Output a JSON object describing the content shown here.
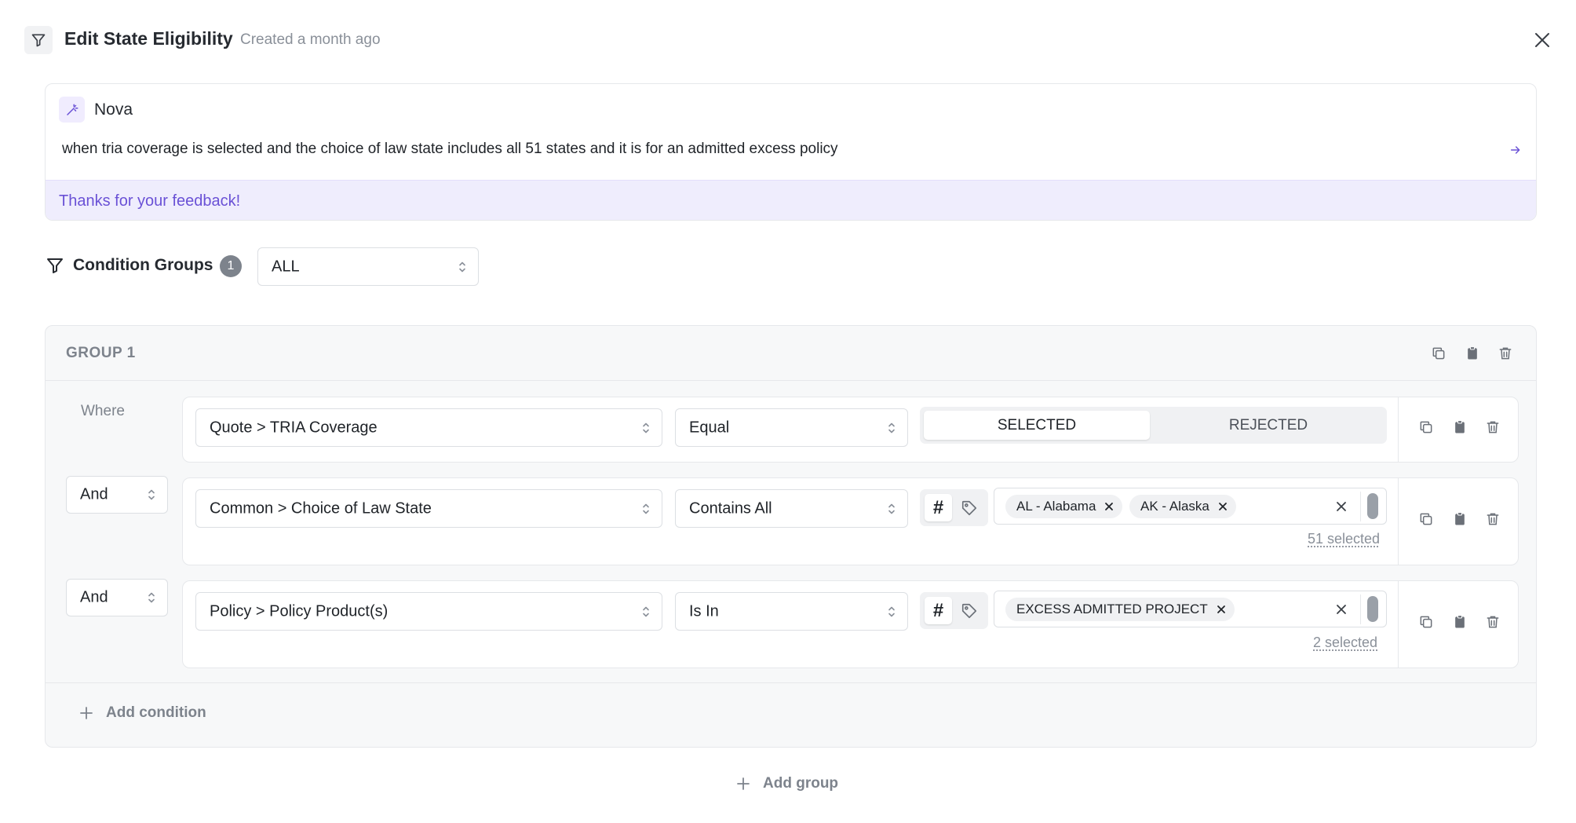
{
  "header": {
    "title": "Edit State Eligibility",
    "subtitle": "Created a month ago"
  },
  "nova": {
    "name": "Nova",
    "prompt": "when tria coverage is selected and the choice of law state includes all 51 states and it is for an admitted excess policy",
    "feedback": "Thanks for your feedback!"
  },
  "condition_groups": {
    "label": "Condition Groups",
    "count": "1",
    "match_mode": "ALL"
  },
  "group": {
    "title": "GROUP 1",
    "where_label": "Where",
    "add_condition": "Add condition",
    "rows": [
      {
        "field": "Quote > TRIA Coverage",
        "operator": "Equal",
        "options": [
          "SELECTED",
          "REJECTED"
        ],
        "selected_option": "SELECTED"
      },
      {
        "connector": "And",
        "field": "Common > Choice of Law State",
        "operator": "Contains All",
        "values": [
          "AL - Alabama",
          "AK - Alaska"
        ],
        "selected_count": "51 selected"
      },
      {
        "connector": "And",
        "field": "Policy > Policy Product(s)",
        "operator": "Is In",
        "values": [
          "EXCESS ADMITTED PROJECT"
        ],
        "selected_count": "2 selected"
      }
    ]
  },
  "add_group": "Add group",
  "colors": {
    "accent": "#6a51d6",
    "feedback_bg": "#efedfd",
    "muted_text": "#7d838c",
    "border": "#e6e8eb"
  }
}
